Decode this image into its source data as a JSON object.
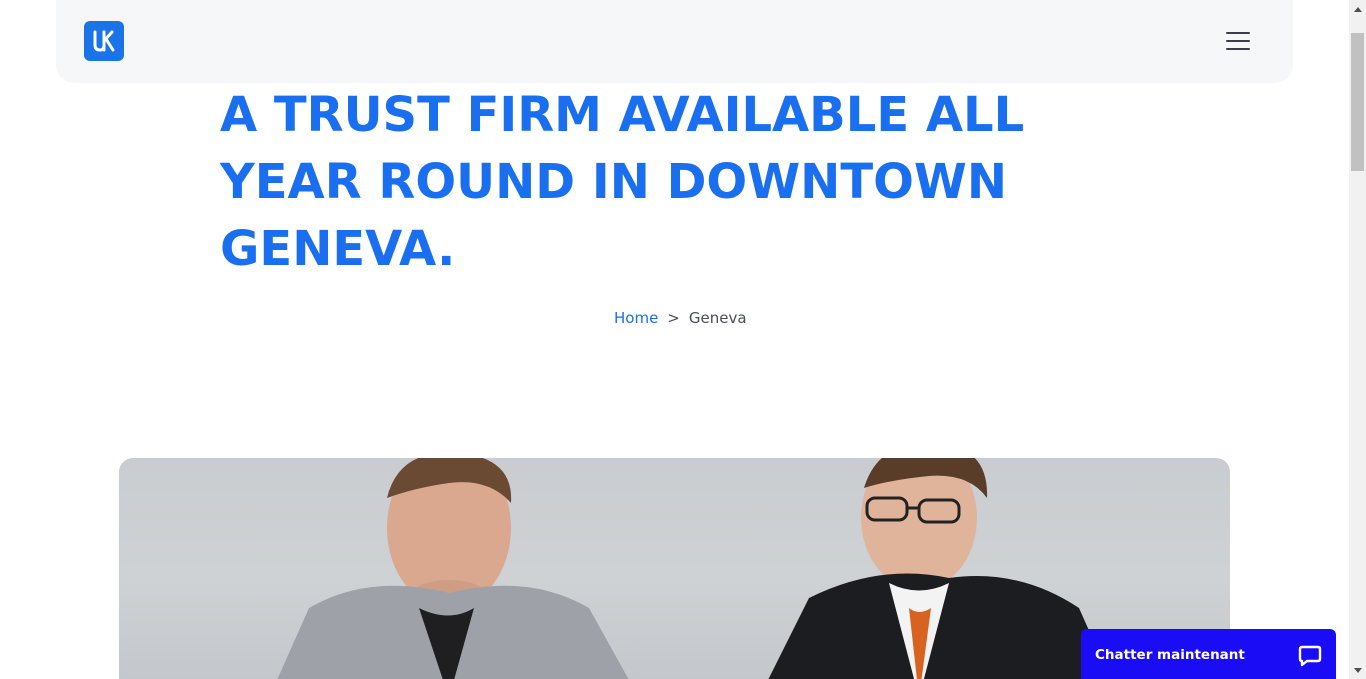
{
  "header": {
    "logo_alt": "UK logo",
    "menu_icon": "hamburger-menu-icon"
  },
  "hero": {
    "title": "A TRUST FIRM AVAILABLE ALL YEAR ROUND IN DOWNTOWN GENEVA."
  },
  "breadcrumb": {
    "home_label": "Home",
    "separator": ">",
    "current_label": "Geneva"
  },
  "chat": {
    "label": "Chatter maintenant",
    "icon": "chat-bubble-icon"
  },
  "colors": {
    "accent": "#1a6ff0",
    "chat_bg": "#1a0df5",
    "header_bg": "#f6f7f9"
  }
}
